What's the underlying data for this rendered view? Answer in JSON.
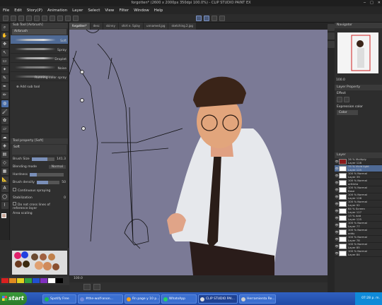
{
  "window": {
    "title": "forgotten* (2600 x 2000px 350dpi 100.0%) - CLIP STUDIO PAINT EX"
  },
  "menu": [
    "File",
    "Edit",
    "Story(P)",
    "Animation",
    "Layer",
    "Select",
    "View",
    "Filter",
    "Window",
    "Help"
  ],
  "canvas_tabs": [
    "forgotten*",
    "desc",
    "skinny",
    "shirt e. Splay",
    "unnamed.jpg",
    "sketching.2.jpg"
  ],
  "subtool": {
    "header": "Sub Tool [Airbrush]",
    "group": "Airbrush",
    "brushes": [
      "Soft",
      "Spray",
      "Droplet",
      "Noise",
      "Running color spray"
    ],
    "add_label": "Add sub tool"
  },
  "toolprop": {
    "header": "Tool property [Soft]",
    "name": "Soft",
    "brush_size_label": "Brush Size",
    "brush_size_value": "141.3",
    "blending_label": "Blending mode",
    "blending_value": "Normal",
    "hardness_label": "Hardness",
    "density_label": "Brush density",
    "density_value": "50",
    "continuous_label": "Continuous spraying",
    "stabilization_label": "Stabilization",
    "stabilization_value": "0",
    "refer_label": "Do not cross lines of reference layer",
    "area_label": "Area scaling"
  },
  "status": {
    "zoom": "100.0"
  },
  "navigator": {
    "header": "Navigator",
    "zoom": "100.0"
  },
  "layer_property": {
    "header": "Layer Property",
    "effect": "Effect",
    "expression_label": "Expression color",
    "expression_value": "Color"
  },
  "layers": {
    "header": "Layer",
    "rows": [
      {
        "mode": "26 % Multiply",
        "name": "Layer 128"
      },
      {
        "mode": "75 % Vivid light",
        "name": "Layer 125"
      },
      {
        "mode": "100 % Normal",
        "name": "Layer 39"
      },
      {
        "mode": "100 % Normal",
        "name": "arttinta"
      },
      {
        "mode": "100 % Normal",
        "name": "Base"
      },
      {
        "mode": "100 % Normal",
        "name": "Layer 126"
      },
      {
        "mode": "100 % Normal",
        "name": "Layer 92"
      },
      {
        "mode": "64 % Screen",
        "name": "Layer 127"
      },
      {
        "mode": "13 % Add",
        "name": "Layer 125"
      },
      {
        "mode": "100 % Normal",
        "name": "Layer 77"
      },
      {
        "mode": "100 % Normal",
        "name": "oddy"
      },
      {
        "mode": "100 % Normal",
        "name": "Layer 78"
      },
      {
        "mode": "100 % Normal",
        "name": "Layer 85"
      },
      {
        "mode": "100 % Normal",
        "name": "Layer 84"
      }
    ]
  },
  "taskbar": {
    "start": "start",
    "buttons": [
      "Spotify Free",
      "#the-wolf-anon...",
      "Rn page y 10 p...",
      "WhatsApp",
      "CLIP STUDIO PAI...",
      "Herramienta Re..."
    ],
    "time": "07:28 p. m."
  },
  "colors": {
    "canvas_bg": "#7b7a96",
    "accent": "#4f6a95"
  }
}
